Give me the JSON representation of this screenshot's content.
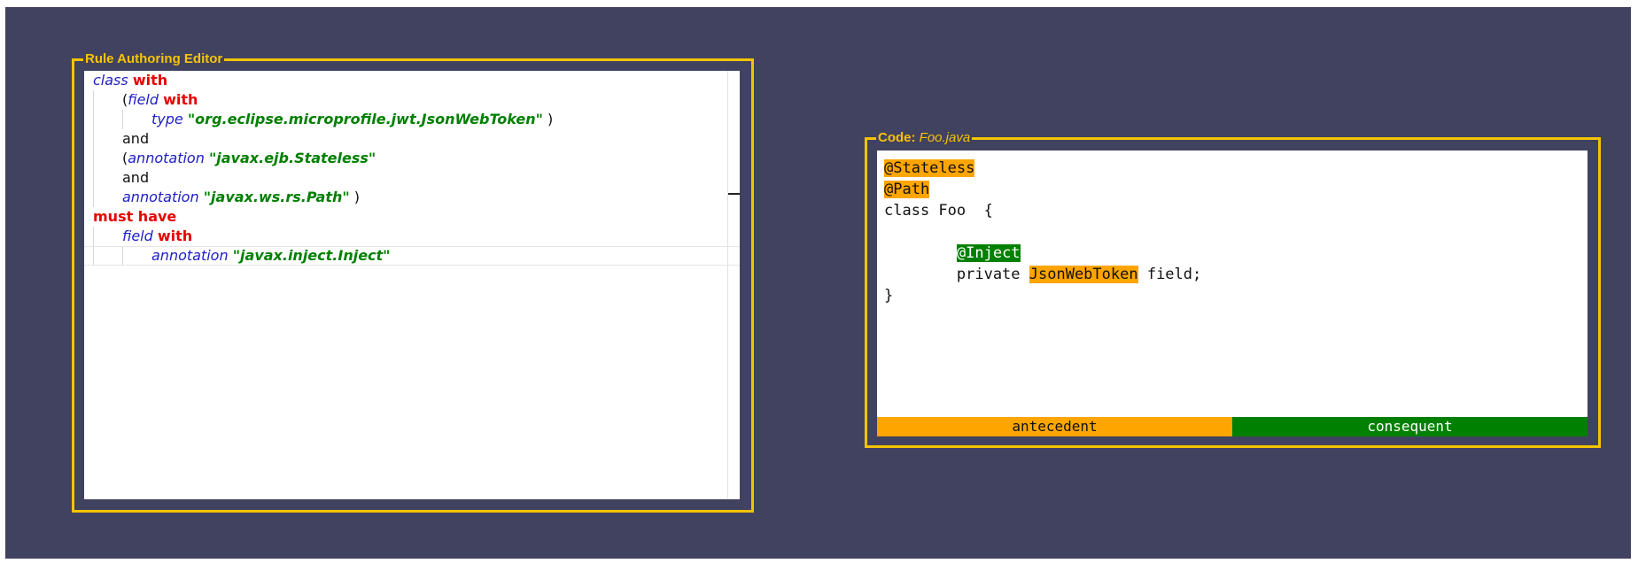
{
  "rule_panel": {
    "title": "Rule Authoring Editor",
    "lines": [
      {
        "indent": 0,
        "tokens": [
          {
            "t": "class",
            "c": "kw-blue"
          },
          {
            "t": " ",
            "c": "txt"
          },
          {
            "t": "with",
            "c": "kw-red"
          }
        ]
      },
      {
        "indent": 1,
        "tokens": [
          {
            "t": "(",
            "c": "txt"
          },
          {
            "t": "field",
            "c": "kw-blue"
          },
          {
            "t": " ",
            "c": "txt"
          },
          {
            "t": "with",
            "c": "kw-red"
          }
        ]
      },
      {
        "indent": 2,
        "tokens": [
          {
            "t": "type",
            "c": "kw-blue"
          },
          {
            "t": " ",
            "c": "txt"
          },
          {
            "t": "\"org.eclipse.microprofile.jwt.JsonWebToken\"",
            "c": "str-green"
          },
          {
            "t": " )",
            "c": "txt"
          }
        ]
      },
      {
        "indent": 1,
        "tokens": [
          {
            "t": "and",
            "c": "txt"
          }
        ]
      },
      {
        "indent": 1,
        "tokens": [
          {
            "t": "(",
            "c": "txt"
          },
          {
            "t": "annotation",
            "c": "kw-blue"
          },
          {
            "t": " ",
            "c": "txt"
          },
          {
            "t": "\"javax.ejb.Stateless\"",
            "c": "str-green"
          }
        ]
      },
      {
        "indent": 1,
        "tokens": [
          {
            "t": "and",
            "c": "txt"
          }
        ]
      },
      {
        "indent": 1,
        "tokens": [
          {
            "t": "annotation",
            "c": "kw-blue"
          },
          {
            "t": " ",
            "c": "txt"
          },
          {
            "t": "\"javax.ws.rs.Path\"",
            "c": "str-green"
          },
          {
            "t": " )",
            "c": "txt"
          }
        ]
      },
      {
        "indent": 0,
        "tokens": [
          {
            "t": "must have",
            "c": "kw-red"
          }
        ]
      },
      {
        "indent": 1,
        "tokens": [
          {
            "t": "field",
            "c": "kw-blue"
          },
          {
            "t": " ",
            "c": "txt"
          },
          {
            "t": "with",
            "c": "kw-red"
          }
        ]
      },
      {
        "indent": 2,
        "active": true,
        "tokens": [
          {
            "t": "annotation",
            "c": "kw-blue"
          },
          {
            "t": " ",
            "c": "txt"
          },
          {
            "t": "\"javax.inject.Inject\"",
            "c": "str-green"
          }
        ]
      }
    ]
  },
  "code_panel": {
    "title_label": "Code",
    "title_sep": ": ",
    "file_name": "Foo.java",
    "lines": [
      [
        {
          "t": "@Stateless",
          "c": "hl-orange"
        }
      ],
      [
        {
          "t": "@Path",
          "c": "hl-orange"
        }
      ],
      [
        {
          "t": "class Foo  {",
          "c": ""
        }
      ],
      [
        {
          "t": " ",
          "c": ""
        }
      ],
      [
        {
          "t": "        ",
          "c": ""
        },
        {
          "t": "@Inject",
          "c": "hl-green"
        }
      ],
      [
        {
          "t": "        private ",
          "c": ""
        },
        {
          "t": "JsonWebToken",
          "c": "hl-orange"
        },
        {
          "t": " field;",
          "c": ""
        }
      ],
      [
        {
          "t": "}",
          "c": ""
        }
      ]
    ],
    "legend": {
      "antecedent": "antecedent",
      "consequent": "consequent"
    }
  },
  "colors": {
    "background": "#414260",
    "panel_border": "#f5c400",
    "antecedent": "#ffa500",
    "consequent": "#008000",
    "keyword": "#2020c8",
    "operator": "#e60000",
    "string": "#008000"
  }
}
